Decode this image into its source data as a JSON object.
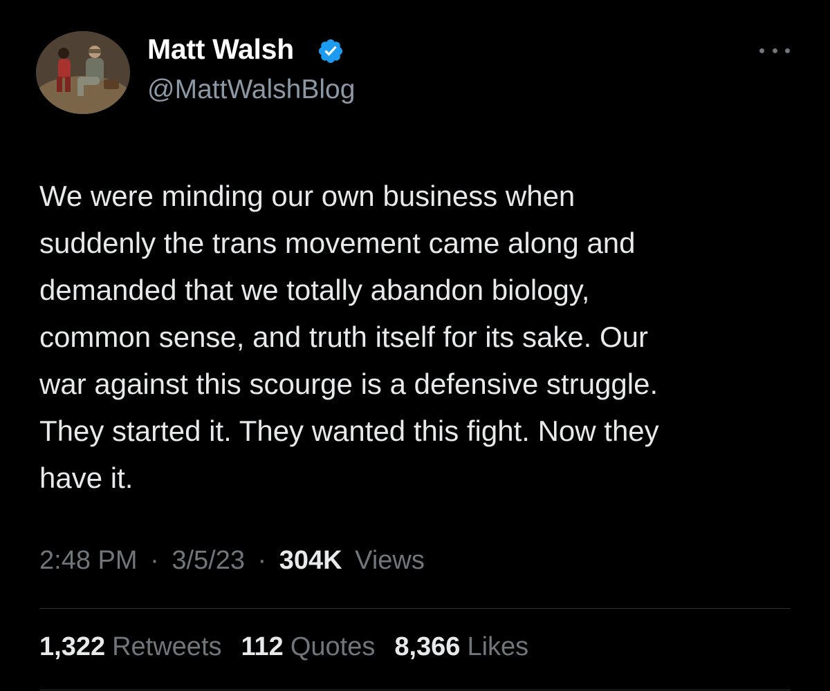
{
  "author": {
    "display_name": "Matt Walsh",
    "handle": "@MattWalshBlog",
    "verified": true,
    "verified_color": "#1d9bf0"
  },
  "more_icon": "more-horizontal-icon",
  "tweet": {
    "text": "We were minding our own business when\nsuddenly the trans movement came along and\ndemanded that we totally abandon biology,\ncommon sense, and truth itself for its sake. Our\nwar against this scourge is a defensive struggle.\nThey started it. They wanted this fight. Now they\nhave it."
  },
  "meta": {
    "time": "2:48 PM",
    "separator": "·",
    "date": "3/5/23",
    "views_count": "304K",
    "views_label": "Views"
  },
  "stats": {
    "retweets_count": "1,322",
    "retweets_label": "Retweets",
    "quotes_count": "112",
    "quotes_label": "Quotes",
    "likes_count": "8,366",
    "likes_label": "Likes"
  },
  "colors": {
    "background": "#000000",
    "primary_text": "#e7e9ea",
    "secondary_text": "#71767b",
    "divider": "#2f3336"
  }
}
